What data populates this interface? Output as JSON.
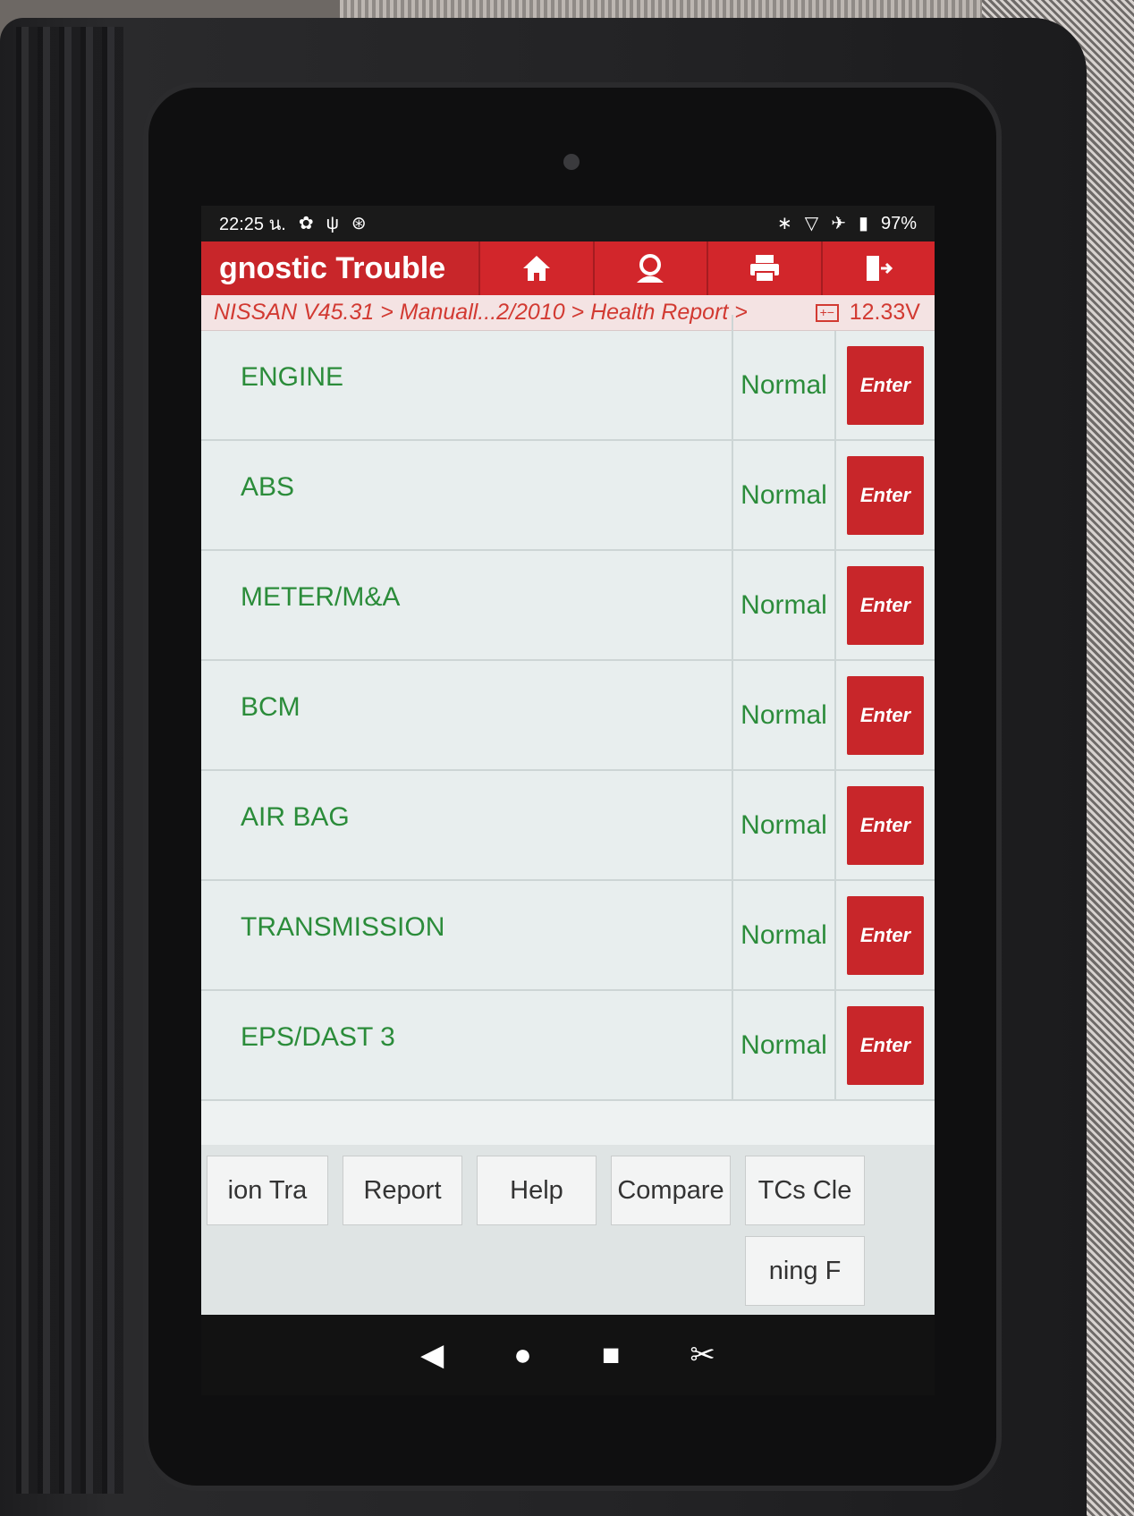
{
  "status_bar": {
    "time": "22:25 น.",
    "left_icons": [
      "gear-icon",
      "usb-debug-icon",
      "vpn-icon"
    ],
    "right_icons": [
      "bluetooth-icon",
      "wifi-icon",
      "airplane-icon",
      "battery-icon"
    ],
    "battery": "97%"
  },
  "title_bar": {
    "title": "gnostic Trouble",
    "buttons": [
      "home-icon",
      "support-icon",
      "print-icon",
      "exit-icon"
    ]
  },
  "breadcrumb": {
    "path": "NISSAN V45.31 > Manuall...2/2010 > Health Report >",
    "voltage": "12.33V"
  },
  "systems": [
    {
      "name": "ENGINE",
      "status": "Normal",
      "action": "Enter"
    },
    {
      "name": "ABS",
      "status": "Normal",
      "action": "Enter"
    },
    {
      "name": "METER/M&A",
      "status": "Normal",
      "action": "Enter"
    },
    {
      "name": "BCM",
      "status": "Normal",
      "action": "Enter"
    },
    {
      "name": "AIR BAG",
      "status": "Normal",
      "action": "Enter"
    },
    {
      "name": "TRANSMISSION",
      "status": "Normal",
      "action": "Enter"
    },
    {
      "name": "EPS/DAST 3",
      "status": "Normal",
      "action": "Enter"
    }
  ],
  "toolbar": {
    "btn_1": "ion     Tra",
    "report": "Report",
    "help": "Help",
    "compare": "Compare",
    "btn_5": "TCs     Cle",
    "btn_6": "ning      F"
  },
  "colors": {
    "accent": "#c8262a",
    "status_green": "#2b8c3a",
    "breadcrumb_text": "#d23a32"
  }
}
